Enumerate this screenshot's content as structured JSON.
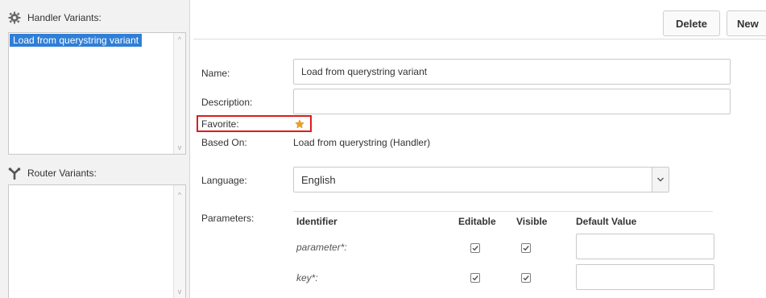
{
  "toolbar": {
    "delete_label": "Delete",
    "new_label": "New"
  },
  "handler_variants": {
    "title": "Handler Variants:",
    "icon": "gear-icon",
    "items": [
      "Load from querystring variant"
    ],
    "selected_index": 0
  },
  "router_variants": {
    "title": "Router Variants:",
    "icon": "fork-icon",
    "items": []
  },
  "form": {
    "name_label": "Name:",
    "name_value": "Load from querystring variant",
    "description_label": "Description:",
    "description_value": "",
    "favorite_label": "Favorite:",
    "favorite_icon": "star-icon",
    "based_on_label": "Based On:",
    "based_on_value": "Load from querystring (Handler)",
    "language_label": "Language:",
    "language_value": "English",
    "parameters_label": "Parameters:"
  },
  "parameters": {
    "columns": [
      "Identifier",
      "Editable",
      "Visible",
      "Default Value"
    ],
    "rows": [
      {
        "identifier": "parameter*:",
        "editable": true,
        "visible": true,
        "default_value": ""
      },
      {
        "identifier": "key*:",
        "editable": true,
        "visible": true,
        "default_value": ""
      }
    ]
  },
  "colors": {
    "accent": "#2f7fd6",
    "highlight": "#e01b1b",
    "star": "#f0a020"
  }
}
